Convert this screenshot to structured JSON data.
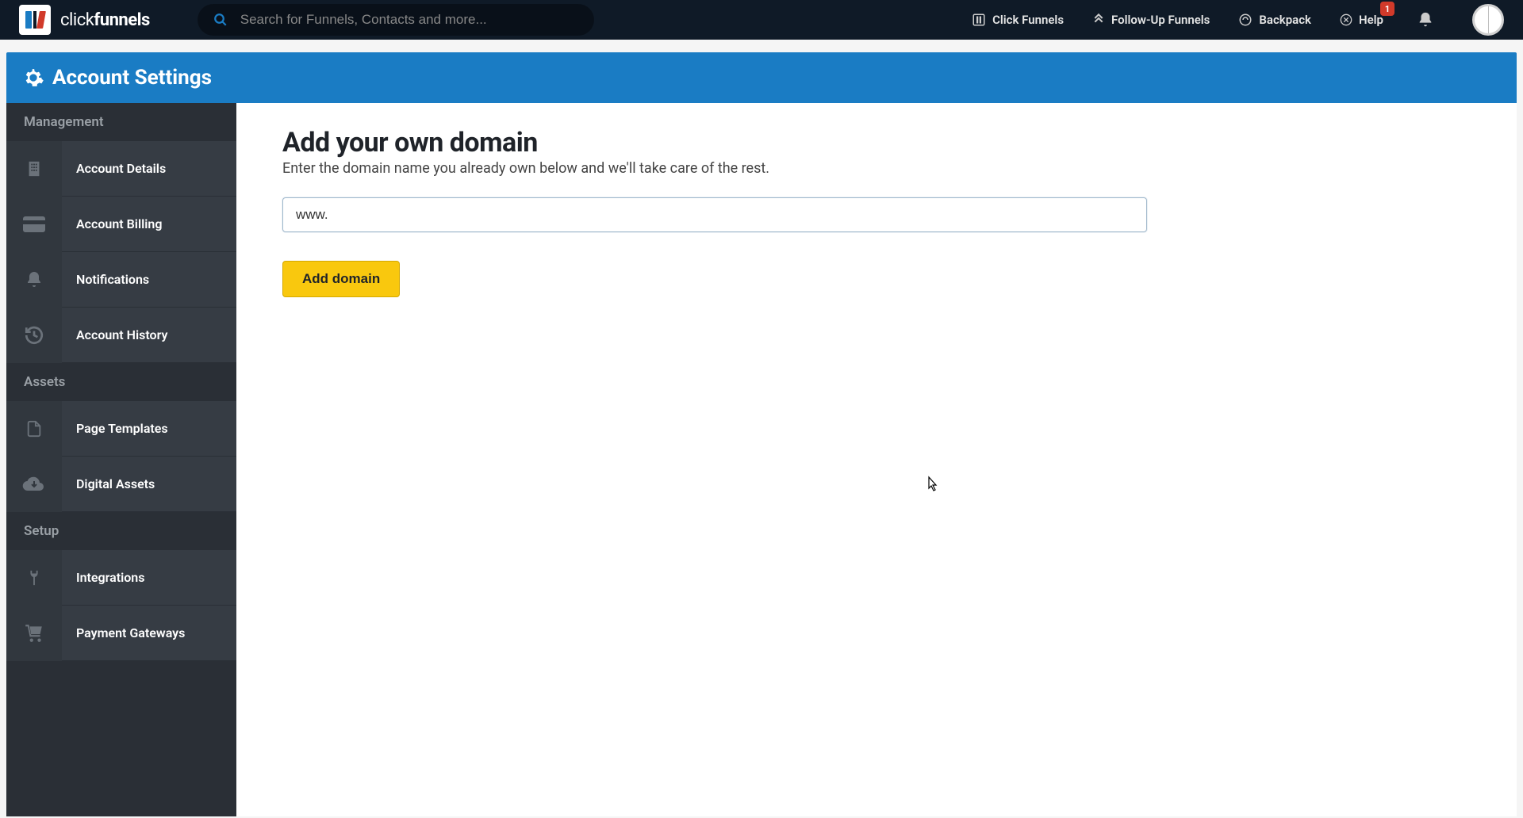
{
  "brand": {
    "name_light": "click",
    "name_bold": "funnels"
  },
  "search": {
    "placeholder": "Search for Funnels, Contacts and more..."
  },
  "topnav": {
    "click_funnels": "Click Funnels",
    "follow_up": "Follow-Up Funnels",
    "backpack": "Backpack",
    "help": "Help",
    "help_badge": "1"
  },
  "page": {
    "title": "Account Settings"
  },
  "sidebar": {
    "sections": {
      "management": "Management",
      "assets": "Assets",
      "setup": "Setup"
    },
    "items": {
      "account_details": "Account Details",
      "account_billing": "Account Billing",
      "notifications": "Notifications",
      "account_history": "Account History",
      "page_templates": "Page Templates",
      "digital_assets": "Digital Assets",
      "integrations": "Integrations",
      "payment_gateways": "Payment Gateways"
    }
  },
  "main": {
    "heading": "Add your own domain",
    "subtitle": "Enter the domain name you already own below and we'll take care of the rest.",
    "domain_value": "www.",
    "add_button": "Add domain"
  }
}
